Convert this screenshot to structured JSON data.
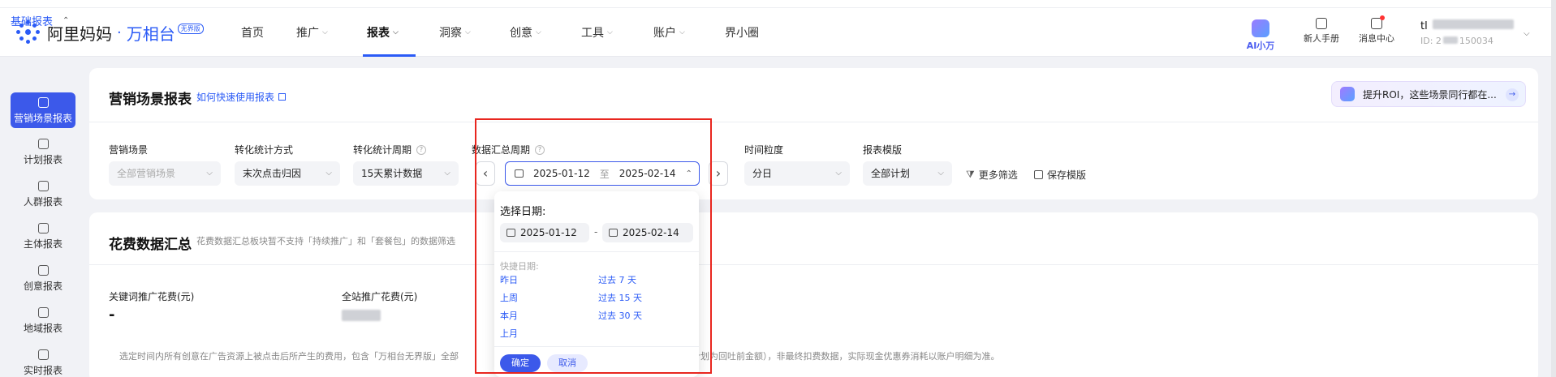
{
  "brand": {
    "name": "阿里妈妈",
    "product": "万相台",
    "badge": "无界版"
  },
  "nav": [
    {
      "label": "首页",
      "chevron": false
    },
    {
      "label": "推广",
      "chevron": true
    },
    {
      "label": "报表",
      "chevron": true,
      "active": true
    },
    {
      "label": "洞察",
      "chevron": true
    },
    {
      "label": "创意",
      "chevron": true
    },
    {
      "label": "工具",
      "chevron": true
    },
    {
      "label": "账户",
      "chevron": true
    },
    {
      "label": "界小圈",
      "chevron": false
    }
  ],
  "top_tools": {
    "ai": "AI小万",
    "manual": "新人手册",
    "messages": "消息中心"
  },
  "user": {
    "name": "tl",
    "id_prefix": "ID: 2",
    "id_suffix": "150034"
  },
  "sidebar": {
    "group": "基础报表",
    "items": [
      {
        "label": "营销场景报表",
        "icon": "report-icon",
        "active": true
      },
      {
        "label": "计划报表",
        "icon": "report-icon"
      },
      {
        "label": "人群报表",
        "icon": "report-icon"
      },
      {
        "label": "主体报表",
        "icon": "report-icon"
      },
      {
        "label": "创意报表",
        "icon": "report-icon"
      },
      {
        "label": "地域报表",
        "icon": "report-icon"
      },
      {
        "label": "实时报表",
        "icon": "report-icon"
      }
    ]
  },
  "report": {
    "title": "营销场景报表",
    "help_link": "如何快速使用报表",
    "banner": "提升ROI，这些场景同行都在...",
    "filters": {
      "scene": {
        "label": "营销场景",
        "value": "全部营销场景"
      },
      "conversion_method": {
        "label": "转化统计方式",
        "value": "末次点击归因"
      },
      "conversion_period": {
        "label": "转化统计周期",
        "value": "15天累计数据"
      },
      "summary_period": {
        "label": "数据汇总周期",
        "start": "2025-01-12",
        "separator": "至",
        "end": "2025-02-14"
      },
      "granularity": {
        "label": "时间粒度",
        "value": "分日"
      },
      "template": {
        "label": "报表模版",
        "value": "全部计划"
      }
    },
    "more_filters": "更多筛选",
    "save_template": "保存模版"
  },
  "spend_summary": {
    "title": "花费数据汇总",
    "note": "花费数据汇总板块暂不支持「持续推广」和「套餐包」的数据筛选",
    "metrics": [
      {
        "label": "关键词推广花费(元)",
        "value": "-"
      },
      {
        "label": "全站推广花费(元)",
        "value": ""
      }
    ],
    "footnote_left": "选定时间内所有创意在广告资源上被点击后所产生的费用，包含「万相台无界版」全部",
    "footnote_right": "加购计划为回吐前金额），非最终扣费数据，实际现金优惠券消耗以账户明细为准。"
  },
  "date_picker": {
    "title": "选择日期:",
    "start": "2025-01-12",
    "end": "2025-02-14",
    "dash": "-",
    "quick_label": "快捷日期:",
    "quick_left": [
      "昨日",
      "上周",
      "本月",
      "上月"
    ],
    "quick_right": [
      "过去 7 天",
      "过去 15 天",
      "过去 30 天"
    ],
    "confirm": "确定",
    "cancel": "取消"
  },
  "colors": {
    "accent": "#3c59ea",
    "highlight_box": "#e8261f"
  }
}
